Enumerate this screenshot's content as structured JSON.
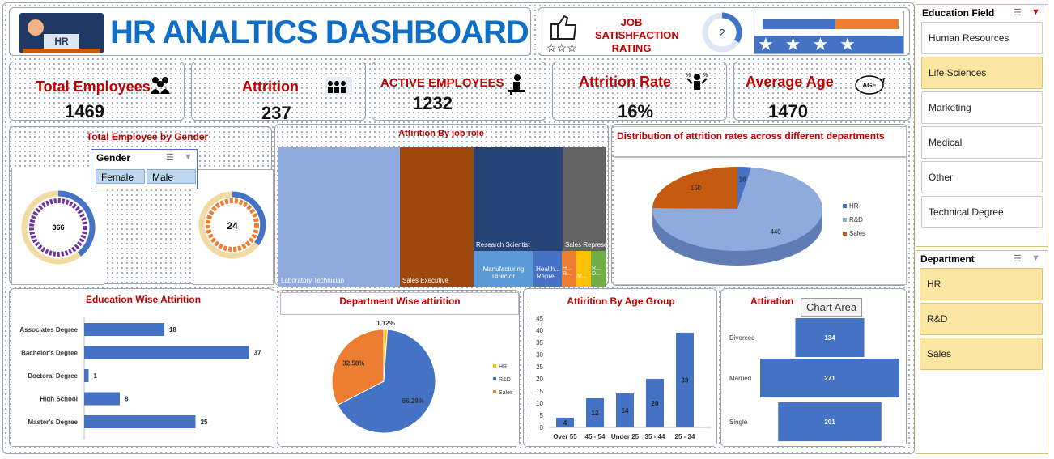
{
  "header": {
    "title": "HR ANALTICS DASHBOARD",
    "logo_text": "HR",
    "job_sat_label": "JOB SATISHFACTION RATING",
    "rating_value": "2"
  },
  "kpis": [
    {
      "title": "Total Employees",
      "value": "1469",
      "icon": "people-icon"
    },
    {
      "title": "Attrition",
      "value": "237",
      "icon": "team-icon"
    },
    {
      "title": "ACTIVE EMPLOYEES",
      "value": "1232",
      "icon": "desk-worker-icon"
    },
    {
      "title": "Attrition Rate",
      "value": "16%",
      "icon": "percent-person-icon"
    },
    {
      "title": "Average Age",
      "value": "1470",
      "icon": "age-icon"
    }
  ],
  "gender_card": {
    "title": "Total Employee by Gender",
    "female_value": "366",
    "male_value": "24"
  },
  "gender_slicer": {
    "title": "Gender",
    "options": [
      "Female",
      "Male"
    ]
  },
  "education_field_slicer": {
    "title": "Education Field",
    "options": [
      {
        "label": "Human Resources",
        "selected": false
      },
      {
        "label": "Life Sciences",
        "selected": true
      },
      {
        "label": "Marketing",
        "selected": false
      },
      {
        "label": "Medical",
        "selected": false
      },
      {
        "label": "Other",
        "selected": false
      },
      {
        "label": "Technical Degree",
        "selected": false
      }
    ]
  },
  "department_slicer": {
    "title": "Department",
    "options": [
      "HR",
      "R&D",
      "Sales"
    ]
  },
  "tooltip": "Chart Area",
  "colors": {
    "blue": "#4472c4",
    "orange": "#ed7d31",
    "rust": "#c55a11",
    "light_blue": "#8faadc",
    "red_title": "#c00000"
  },
  "chart_data": [
    {
      "id": "job-role-treemap",
      "type": "treemap",
      "title": "Attirition By job role",
      "labels": [
        "Laboratory Technician",
        "Sales Executive",
        "Research Scientist",
        "Sales Representa...",
        "Manufacturing Director",
        "Health... Repre...",
        "H... R...",
        "M...",
        "R... D..."
      ]
    },
    {
      "id": "dept-dist-pie3d",
      "type": "pie",
      "title": "Distribution of attrition rates across different departments",
      "categories": [
        "HR",
        "R&D",
        "Sales"
      ],
      "values": [
        16,
        440,
        150
      ],
      "legend": "right"
    },
    {
      "id": "edu-attrition",
      "type": "bar",
      "title": "Education Wise Attirition",
      "categories": [
        "Associates Degree",
        "Bachelor's Degree",
        "Doctoral Degree",
        "High School",
        "Master's Degree"
      ],
      "values": [
        18,
        37,
        1,
        8,
        25
      ]
    },
    {
      "id": "dept-attrition",
      "type": "pie",
      "title": "Department Wise attirition",
      "categories": [
        "HR",
        "R&D",
        "Sales"
      ],
      "values": [
        1.12,
        66.29,
        32.58
      ],
      "data_labels": [
        "1.12%",
        "66.29%",
        "32.58%"
      ],
      "legend": "right"
    },
    {
      "id": "age-attrition",
      "type": "bar",
      "title": "Attirition By Age Group",
      "categories": [
        "Over 55",
        "45 - 54",
        "Under 25",
        "35 - 44",
        "25 - 34"
      ],
      "values": [
        4,
        12,
        14,
        20,
        39
      ],
      "ylim": [
        0,
        45
      ],
      "yticks": [
        0,
        5,
        10,
        15,
        20,
        25,
        30,
        35,
        40,
        45
      ]
    },
    {
      "id": "marital-attrition",
      "type": "bar",
      "title": "Attiration",
      "categories": [
        "Divorced",
        "Married",
        "Single"
      ],
      "values": [
        134,
        271,
        201
      ]
    }
  ]
}
